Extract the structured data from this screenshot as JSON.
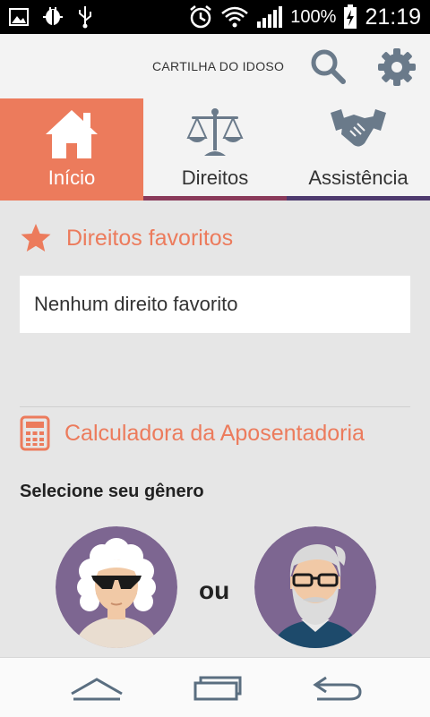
{
  "status_bar": {
    "battery_percent": "100%",
    "time": "21:19",
    "icons": [
      "image-icon",
      "android-debug-icon",
      "usb-icon",
      "alarm-icon",
      "wifi-icon",
      "signal-icon",
      "battery-charging-icon"
    ]
  },
  "header": {
    "title": "CARTILHA DO IDOSO",
    "search_icon": "search-icon",
    "settings_icon": "gear-icon"
  },
  "tabs": [
    {
      "label": "Início",
      "icon": "home-icon",
      "active": true,
      "color": "#ec7b5c"
    },
    {
      "label": "Direitos",
      "icon": "scales-icon",
      "active": false,
      "color": "#8a3a5a"
    },
    {
      "label": "Assistência",
      "icon": "handshake-icon",
      "active": false,
      "color": "#4e3a6e"
    }
  ],
  "favorites": {
    "title": "Direitos favoritos",
    "icon": "star-icon",
    "empty_text": "Nenhum direito favorito"
  },
  "calculator": {
    "title": "Calculadora da Aposentadoria",
    "icon": "calculator-icon",
    "select_label": "Selecione seu gênero",
    "or_text": "ou",
    "options": [
      {
        "name": "female",
        "icon": "elderly-woman-avatar"
      },
      {
        "name": "male",
        "icon": "elderly-man-avatar"
      }
    ]
  },
  "nav_bar": {
    "buttons": [
      "home-nav-icon",
      "recent-apps-icon",
      "back-icon"
    ]
  },
  "colors": {
    "accent": "#ec7b5c",
    "tab_underline_direitos": "#8a3a5a",
    "tab_underline_assistencia": "#4e3a6e",
    "avatar_bg": "#7d6691",
    "icon_gray": "#6a7a8a"
  }
}
